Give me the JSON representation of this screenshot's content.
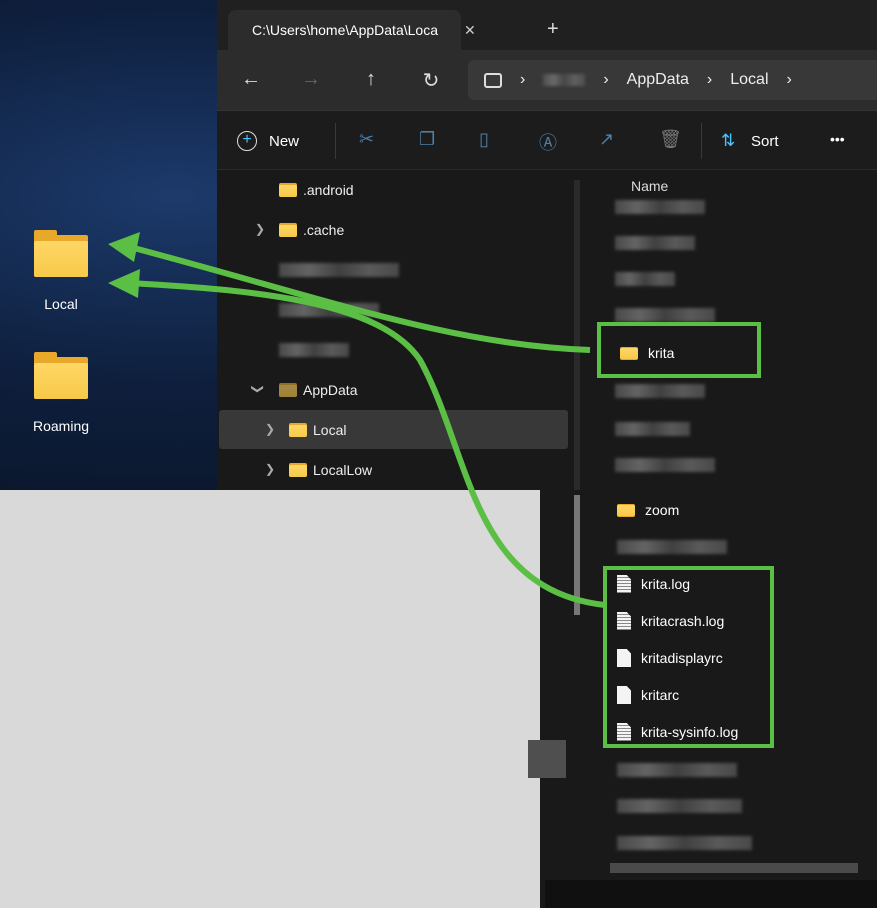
{
  "desktop": {
    "icons": [
      {
        "label": "Local"
      },
      {
        "label": "Roaming"
      }
    ]
  },
  "window": {
    "tab": {
      "title": "C:\\Users\\home\\AppData\\Loca",
      "close": "✕",
      "new_tab": "+"
    },
    "nav": {
      "back": "←",
      "forward": "→",
      "up": "↑",
      "refresh": "↻"
    },
    "address": {
      "segments": [
        "AppData",
        "Local"
      ],
      "separator": "›"
    },
    "commands": {
      "new_label": "New",
      "sort_label": "Sort",
      "more": "•••"
    },
    "tree": [
      {
        "label": ".android"
      },
      {
        "label": ".cache"
      },
      {
        "label": "AppData"
      },
      {
        "label": "Local"
      },
      {
        "label": "LocalLow"
      }
    ],
    "content": {
      "column_header": "Name",
      "highlighted_folder": "krita",
      "zoom_folder": "zoom",
      "files": [
        {
          "name": "krita.log",
          "type": "text"
        },
        {
          "name": "kritacrash.log",
          "type": "text"
        },
        {
          "name": "kritadisplayrc",
          "type": "blank"
        },
        {
          "name": "kritarc",
          "type": "blank"
        },
        {
          "name": "krita-sysinfo.log",
          "type": "text"
        }
      ]
    }
  },
  "colors": {
    "accent_green": "#5cbf45",
    "folder_yellow": "#f7c948"
  }
}
